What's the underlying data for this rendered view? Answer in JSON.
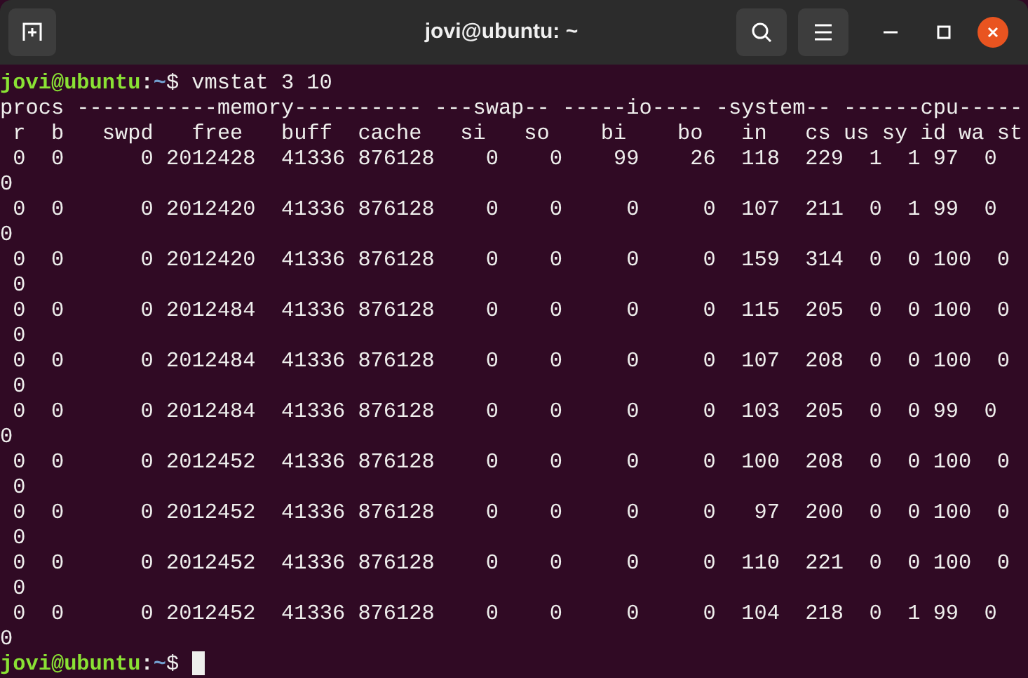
{
  "window": {
    "title": "jovi@ubuntu: ~"
  },
  "terminal": {
    "lines": [
      {
        "kind": "prompt",
        "user_host": "jovi@ubuntu",
        "separator": ":",
        "path": "~",
        "symbol": "$",
        "command": "vmstat 3 10",
        "cursor": false
      },
      {
        "kind": "output",
        "text": "procs -----------memory---------- ---swap-- -----io---- -system-- ------cpu-----"
      },
      {
        "kind": "output",
        "text": " r  b   swpd   free   buff  cache   si   so    bi    bo   in   cs us sy id wa st"
      },
      {
        "kind": "output",
        "text": " 0  0      0 2012428  41336 876128    0    0    99    26  118  229  1  1 97  0"
      },
      {
        "kind": "output",
        "text": "0"
      },
      {
        "kind": "output",
        "text": " 0  0      0 2012420  41336 876128    0    0     0     0  107  211  0  1 99  0"
      },
      {
        "kind": "output",
        "text": "0"
      },
      {
        "kind": "output",
        "text": " 0  0      0 2012420  41336 876128    0    0     0     0  159  314  0  0 100  0"
      },
      {
        "kind": "output",
        "text": " 0"
      },
      {
        "kind": "output",
        "text": " 0  0      0 2012484  41336 876128    0    0     0     0  115  205  0  0 100  0"
      },
      {
        "kind": "output",
        "text": " 0"
      },
      {
        "kind": "output",
        "text": " 0  0      0 2012484  41336 876128    0    0     0     0  107  208  0  0 100  0"
      },
      {
        "kind": "output",
        "text": " 0"
      },
      {
        "kind": "output",
        "text": " 0  0      0 2012484  41336 876128    0    0     0     0  103  205  0  0 99  0"
      },
      {
        "kind": "output",
        "text": "0"
      },
      {
        "kind": "output",
        "text": " 0  0      0 2012452  41336 876128    0    0     0     0  100  208  0  0 100  0"
      },
      {
        "kind": "output",
        "text": " 0"
      },
      {
        "kind": "output",
        "text": " 0  0      0 2012452  41336 876128    0    0     0     0   97  200  0  0 100  0"
      },
      {
        "kind": "output",
        "text": " 0"
      },
      {
        "kind": "output",
        "text": " 0  0      0 2012452  41336 876128    0    0     0     0  110  221  0  0 100  0"
      },
      {
        "kind": "output",
        "text": " 0"
      },
      {
        "kind": "output",
        "text": " 0  0      0 2012452  41336 876128    0    0     0     0  104  218  0  1 99  0"
      },
      {
        "kind": "output",
        "text": "0"
      },
      {
        "kind": "prompt",
        "user_host": "jovi@ubuntu",
        "separator": ":",
        "path": "~",
        "symbol": "$",
        "cursor": true
      }
    ]
  }
}
